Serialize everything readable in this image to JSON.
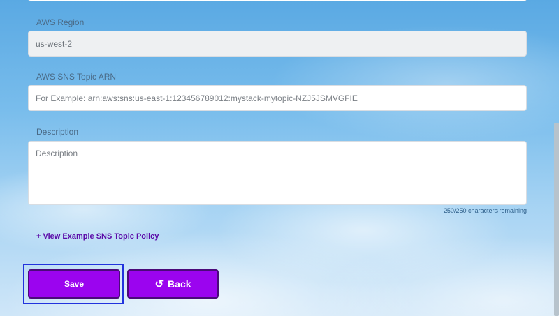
{
  "form": {
    "region": {
      "label": "AWS Region",
      "value": "us-west-2"
    },
    "sns_topic_arn": {
      "label": "AWS SNS Topic ARN",
      "placeholder": "For Example: arn:aws:sns:us-east-1:123456789012:mystack-mytopic-NZJ5JSMVGFIE"
    },
    "description": {
      "label": "Description",
      "placeholder": "Description",
      "char_count": "250/250 characters remaining"
    },
    "policy_link": "+ View Example SNS Topic Policy"
  },
  "actions": {
    "save_label": "Save",
    "back_label": "Back",
    "back_icon": "undo-arrow-icon"
  },
  "colors": {
    "button_purple": "#9b04ef",
    "link_purple": "#5b0aa8",
    "focus_ring": "#2233dd"
  }
}
